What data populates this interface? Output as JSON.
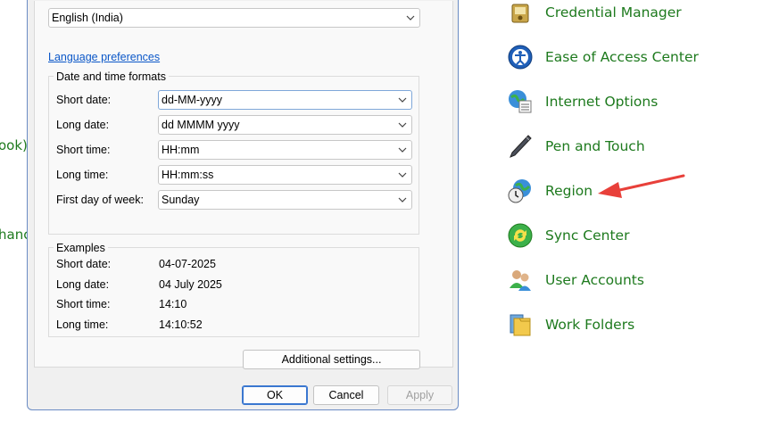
{
  "background": {
    "left_fragments": [
      "ook)",
      "hanc"
    ],
    "control_panel_items": [
      {
        "label": "Credential Manager",
        "icon": "credential-manager-icon"
      },
      {
        "label": "Ease of Access Center",
        "icon": "ease-of-access-icon"
      },
      {
        "label": "Internet Options",
        "icon": "internet-options-icon"
      },
      {
        "label": "Pen and Touch",
        "icon": "pen-icon"
      },
      {
        "label": "Region",
        "icon": "region-globe-clock-icon"
      },
      {
        "label": "Sync Center",
        "icon": "sync-center-icon"
      },
      {
        "label": "User Accounts",
        "icon": "user-accounts-icon"
      },
      {
        "label": "Work Folders",
        "icon": "work-folders-icon"
      }
    ],
    "annotation_color": "#e8403a",
    "link_color": "#1e7a1e"
  },
  "dialog": {
    "format_select": "English (India)",
    "language_preferences_link": "Language preferences",
    "formats_group": {
      "title": "Date and time formats",
      "short_date_label": "Short date:",
      "short_date_value": "dd-MM-yyyy",
      "long_date_label": "Long date:",
      "long_date_value": "dd MMMM yyyy",
      "short_time_label": "Short time:",
      "short_time_value": "HH:mm",
      "long_time_label": "Long time:",
      "long_time_value": "HH:mm:ss",
      "first_day_label": "First day of week:",
      "first_day_value": "Sunday"
    },
    "examples_group": {
      "title": "Examples",
      "short_date_label": "Short date:",
      "short_date_value": "04-07-2025",
      "long_date_label": "Long date:",
      "long_date_value": "04 July 2025",
      "short_time_label": "Short time:",
      "short_time_value": "14:10",
      "long_time_label": "Long time:",
      "long_time_value": "14:10:52"
    },
    "additional_settings_button": "Additional settings...",
    "ok_button": "OK",
    "cancel_button": "Cancel",
    "apply_button": "Apply",
    "accent_color": "#3a77d0"
  }
}
